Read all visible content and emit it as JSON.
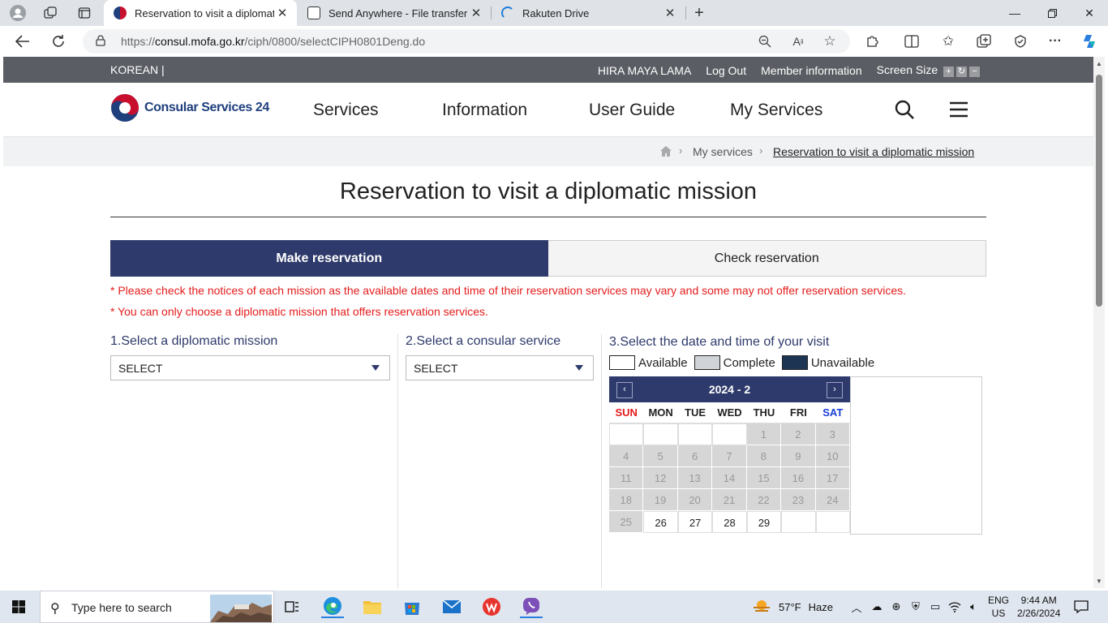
{
  "browser": {
    "tabs": [
      {
        "title": "Reservation to visit a diplomatic mission",
        "active": true
      },
      {
        "title": "Send Anywhere - File transfer",
        "active": false
      },
      {
        "title": "Rakuten Drive",
        "active": false
      }
    ],
    "url_prefix": "https://",
    "url_host": "consul.mofa.go.kr",
    "url_path": "/ciph/0800/selectCIPH0801Deng.do"
  },
  "util": {
    "language": "KOREAN",
    "separator": "|",
    "user_name": "HIRA MAYA LAMA",
    "logout": "Log Out",
    "member_info": "Member information",
    "screen_size": "Screen Size",
    "size_plus": "+",
    "size_reset": "↻",
    "size_minus": "−"
  },
  "header": {
    "logo_text": "Consular Services 24",
    "nav": [
      "Services",
      "Information",
      "User Guide",
      "My Services"
    ]
  },
  "breadcrumb": {
    "items": [
      "My services",
      "Reservation to visit a diplomatic mission"
    ],
    "separator": "›"
  },
  "page": {
    "title": "Reservation to visit a diplomatic mission",
    "tab_make": "Make reservation",
    "tab_check": "Check reservation",
    "notices": [
      "* Please check the notices of each mission as the available dates and time of their reservation services may vary and some may not offer reservation services.",
      "* You can only choose a diplomatic mission that offers reservation services."
    ]
  },
  "step1": {
    "title": "1.Select a diplomatic mission",
    "value": "SELECT"
  },
  "step2": {
    "title": "2.Select a consular service",
    "value": "SELECT"
  },
  "step3": {
    "title": "3.Select the date and time of your visit",
    "legend": [
      {
        "label": "Available",
        "color": "#ffffff"
      },
      {
        "label": "Complete",
        "color": "#d0d3d8"
      },
      {
        "label": "Unavailable",
        "color": "#1d3552"
      }
    ]
  },
  "calendar": {
    "month_label": "2024 - 2",
    "prev": "‹",
    "next": "›",
    "weekdays": [
      "SUN",
      "MON",
      "TUE",
      "WED",
      "THU",
      "FRI",
      "SAT"
    ],
    "weeks": [
      [
        "",
        "",
        "",
        "",
        "1",
        "2",
        "3"
      ],
      [
        "4",
        "5",
        "6",
        "7",
        "8",
        "9",
        "10"
      ],
      [
        "11",
        "12",
        "13",
        "14",
        "15",
        "16",
        "17"
      ],
      [
        "18",
        "19",
        "20",
        "21",
        "22",
        "23",
        "24"
      ],
      [
        "25",
        "26",
        "27",
        "28",
        "29",
        "",
        ""
      ]
    ],
    "available_days": [
      "26",
      "27",
      "28",
      "29"
    ],
    "colors": {
      "header": "#2e3a6b",
      "sun": "#e41c1c",
      "sat": "#1a3fd6"
    }
  },
  "taskbar": {
    "search_placeholder": "Type here to search",
    "weather_temp": "57°F",
    "weather_desc": "Haze",
    "lang_top": "ENG",
    "lang_bottom": "US",
    "time": "9:44 AM",
    "date": "2/26/2024"
  },
  "colors": {
    "brand_navy": "#2e3a6b",
    "notice_red": "#e41c1c",
    "util_bar": "#5a5d63"
  }
}
